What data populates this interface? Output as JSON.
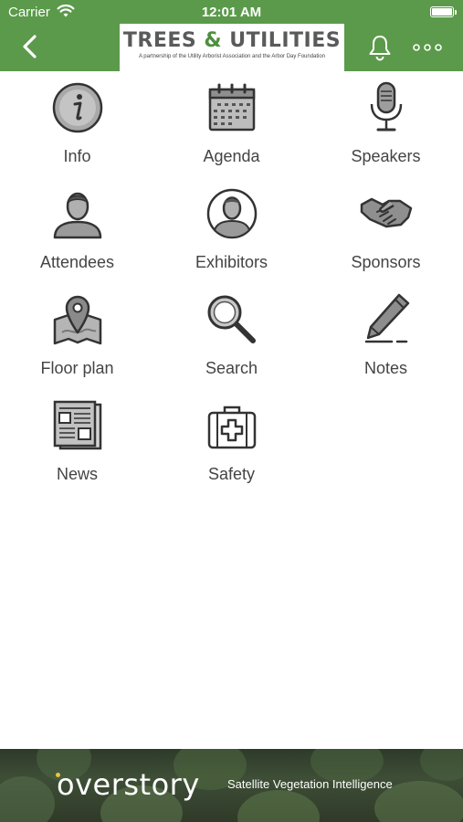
{
  "status_bar": {
    "carrier": "Carrier",
    "time": "12:01 AM"
  },
  "header": {
    "logo_title_part1": "TREES ",
    "logo_amp": "&",
    "logo_title_part2": " UTILITIES",
    "logo_subtitle": "A partnership of the Utility Arborist Association and the Arbor Day Foundation",
    "back_icon": "chevron-left-icon",
    "bell_icon": "bell-icon",
    "more_icon": "more-dots-icon",
    "bar_color": "#5a9a4a"
  },
  "menu": [
    {
      "label": "Info",
      "icon": "info-icon"
    },
    {
      "label": "Agenda",
      "icon": "calendar-icon"
    },
    {
      "label": "Speakers",
      "icon": "microphone-icon"
    },
    {
      "label": "Attendees",
      "icon": "person-icon"
    },
    {
      "label": "Exhibitors",
      "icon": "person-circle-icon"
    },
    {
      "label": "Sponsors",
      "icon": "handshake-icon"
    },
    {
      "label": "Floor plan",
      "icon": "map-pin-icon"
    },
    {
      "label": "Search",
      "icon": "magnifier-icon"
    },
    {
      "label": "Notes",
      "icon": "pen-icon"
    },
    {
      "label": "News",
      "icon": "newspaper-icon"
    },
    {
      "label": "Safety",
      "icon": "first-aid-kit-icon"
    }
  ],
  "ad": {
    "brand": "overstory",
    "tagline": "Satellite Vegetation Intelligence"
  }
}
